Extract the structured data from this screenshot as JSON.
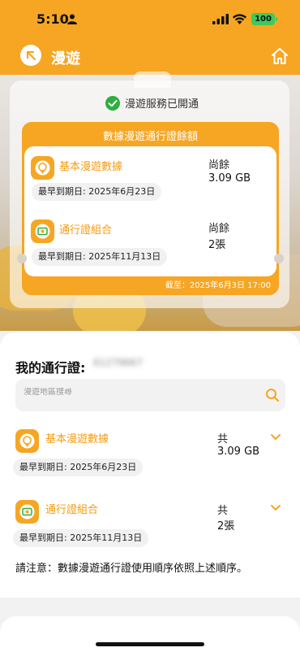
{
  "status_bar": {
    "time": "5:10",
    "battery": "100"
  },
  "header": {
    "title": "漫遊"
  },
  "hero": {
    "service_status": "漫遊服務已開通",
    "balance_card": {
      "title": "數據漫遊通行證餘額",
      "as_of": "截至：2025年6月3日 17:00",
      "items": [
        {
          "name": "基本漫遊數據",
          "remaining_label": "尚餘",
          "remaining_value": "3.09 GB",
          "expiry": "最早到期日: 2025年6月23日"
        },
        {
          "name": "通行證組合",
          "remaining_label": "尚餘",
          "remaining_value": "2張",
          "expiry": "最早到期日: 2025年11月13日"
        }
      ]
    }
  },
  "my_passes": {
    "title": "我的通行證:",
    "number": "61279667",
    "search_placeholder": "漫遊地區搜尋",
    "items": [
      {
        "name": "基本漫遊數據",
        "total_label": "共",
        "total_value": "3.09 GB",
        "expiry": "最早到期日: 2025年6月23日"
      },
      {
        "name": "通行證組合",
        "total_label": "共",
        "total_value": "2張",
        "expiry": "最早到期日: 2025年11月13日"
      }
    ],
    "notice": "請注意：數據漫遊通行證使用順序依照上述順序。"
  },
  "colors": {
    "accent": "#f6a623",
    "accent_text": "#f39c12",
    "check": "#2eae3e"
  }
}
